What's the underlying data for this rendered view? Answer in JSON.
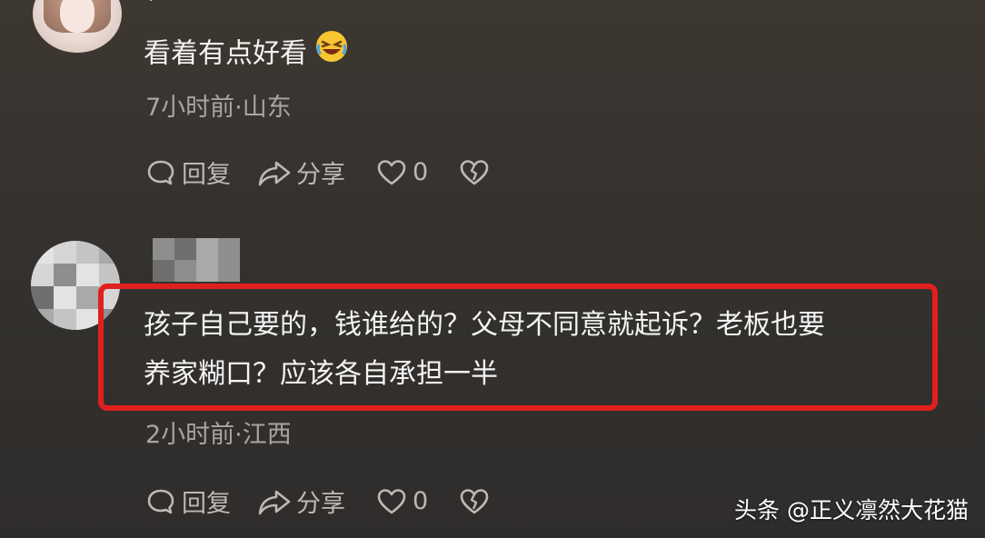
{
  "comments": [
    {
      "text": "看着有点好看",
      "emoji": "rolling-laughing-emoji",
      "meta": "7小时前·山东",
      "actions": {
        "reply": "回复",
        "share": "分享",
        "likes": "0"
      }
    },
    {
      "text_line1": "孩子自己要的，钱谁给的？父母不同意就起诉？老板也要",
      "text_line2": "养家糊口？应该各自承担一半",
      "meta": "2小时前·江西",
      "actions": {
        "reply": "回复",
        "share": "分享",
        "likes": "0"
      }
    }
  ],
  "watermark": "头条 @正义凛然大花猫",
  "colors": {
    "highlight": "#e0201e",
    "background": "#35312d"
  }
}
